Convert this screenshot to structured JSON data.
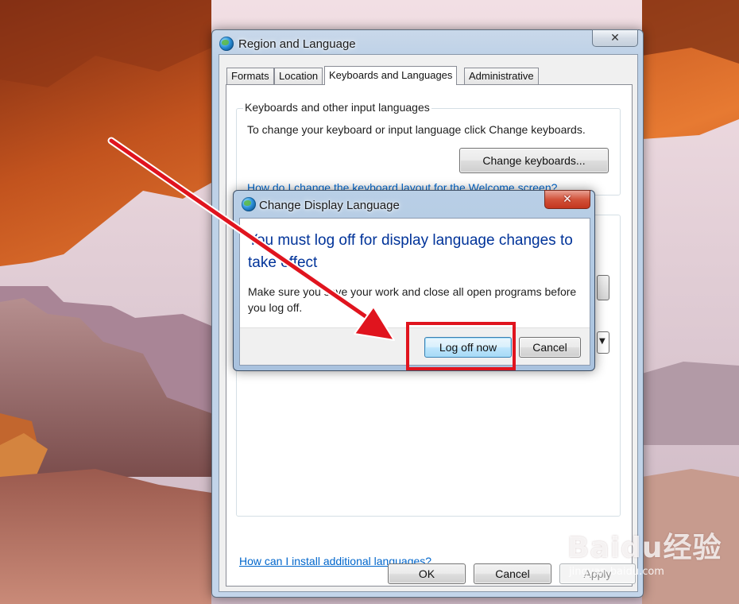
{
  "main_window": {
    "title": "Region and Language",
    "close_glyph": "✕",
    "tabs": [
      {
        "label": "Formats",
        "active": false
      },
      {
        "label": "Location",
        "active": false
      },
      {
        "label": "Keyboards and Languages",
        "active": true
      },
      {
        "label": "Administrative",
        "active": false
      }
    ],
    "keyboards_group": {
      "legend": "Keyboards and other input languages",
      "description": "To change your keyboard or input language click Change keyboards.",
      "change_keyboards_button": "Change keyboards...",
      "welcome_link": "How do I change the keyboard layout for the Welcome screen?"
    },
    "install_link": "How can I install additional languages?",
    "footer_buttons": {
      "ok": "OK",
      "cancel": "Cancel",
      "apply": "Apply"
    }
  },
  "dialog": {
    "title": "Change Display Language",
    "close_glyph": "✕",
    "instruction": "You must log off for display language changes to take effect",
    "body": "Make sure you save your work and close all open programs before you log off.",
    "log_off_button": "Log off now",
    "cancel_button": "Cancel"
  },
  "watermark": {
    "logo_text": "Baidu经验",
    "url": "jingyan.baidu.com"
  },
  "colors": {
    "annotation_red": "#e0141e",
    "instruction_blue": "#003399",
    "link_blue": "#0066cc"
  }
}
